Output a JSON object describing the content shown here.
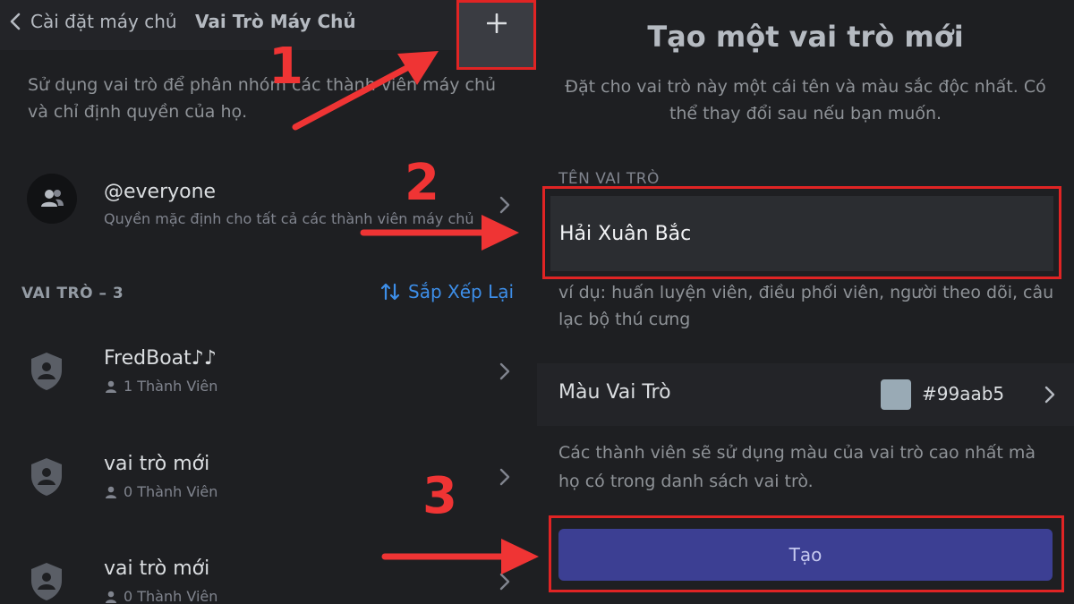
{
  "left": {
    "back_label": "Cài đặt máy chủ",
    "title": "Vai Trò Máy Chủ",
    "description": "Sử dụng vai trò để phân nhóm các thành viên máy chủ và chỉ định quyền của họ.",
    "everyone": {
      "name": "@everyone",
      "subtitle": "Quyền mặc định cho tất cả các thành viên máy chủ"
    },
    "section_label": "VAI TRÒ – 3",
    "sort_label": "Sắp Xếp Lại",
    "roles": [
      {
        "name": "FredBoat♪♪",
        "members": "1 Thành Viên"
      },
      {
        "name": "vai trò mới",
        "members": "0 Thành Viên"
      },
      {
        "name": "vai trò mới",
        "members": "0 Thành Viên"
      }
    ]
  },
  "right": {
    "title": "Tạo một vai trò mới",
    "description": "Đặt cho vai trò này một cái tên và màu sắc độc nhất. Có thể thay đổi sau nếu bạn muốn.",
    "name_label": "TÊN VAI TRÒ",
    "name_value": "Hải Xuân Bắc",
    "hint": "ví dụ: huấn luyện viên, điều phối viên, người theo dõi, câu lạc bộ thú cưng",
    "color_label": "Màu Vai Trò",
    "color_value": "#99aab5",
    "color_description": "Các thành viên sẽ sử dụng màu của vai trò cao nhất mà họ có trong danh sách vai trò.",
    "create_label": "Tạo"
  },
  "annotations": {
    "steps": [
      "1",
      "2",
      "3"
    ]
  },
  "colors": {
    "background": "#1e1f22",
    "accent_red": "#e02424",
    "link_blue": "#3d8ee8",
    "create_button": "#3c3f93"
  }
}
